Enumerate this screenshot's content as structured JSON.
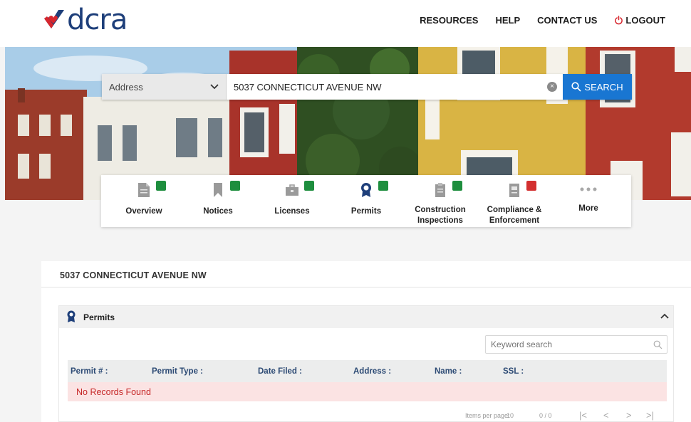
{
  "brand": {
    "logo_text": "dcra"
  },
  "topnav": {
    "resources": "RESOURCES",
    "help": "HELP",
    "contact": "CONTACT US",
    "logout": "LOGOUT"
  },
  "search": {
    "type_value": "Address",
    "query_value": "5037 CONNECTICUT AVENUE NW",
    "button_label": "SEARCH"
  },
  "categories": [
    {
      "label": "Overview",
      "status": "green",
      "icon": "document-icon"
    },
    {
      "label": "Notices",
      "status": "green",
      "icon": "bookmark-icon"
    },
    {
      "label": "Licenses",
      "status": "green",
      "icon": "briefcase-icon"
    },
    {
      "label": "Permits",
      "status": "green",
      "icon": "award-icon"
    },
    {
      "label": "Construction Inspections",
      "status": "green",
      "icon": "clipboard-icon"
    },
    {
      "label": "Compliance & Enforcement",
      "status": "red",
      "icon": "form-icon"
    },
    {
      "label": "More",
      "status": "",
      "icon": "more-dots-icon"
    }
  ],
  "colors": {
    "status_green": "#1e8e3e",
    "status_red": "#d32f2f",
    "accent": "#1976d2",
    "brand_navy": "#1e3f7a",
    "brand_red": "#d7262e"
  },
  "address_title": "5037 CONNECTICUT AVENUE NW",
  "permits": {
    "title": "Permits",
    "keyword_placeholder": "Keyword search",
    "columns": [
      "Permit # :",
      "Permit Type :",
      "Date Filed :",
      "Address :",
      "Name :",
      "SSL :"
    ],
    "empty_message": "No Records Found",
    "items_per_page_label": "Items per page:",
    "items_per_page_value": "10",
    "range": "0 / 0"
  }
}
